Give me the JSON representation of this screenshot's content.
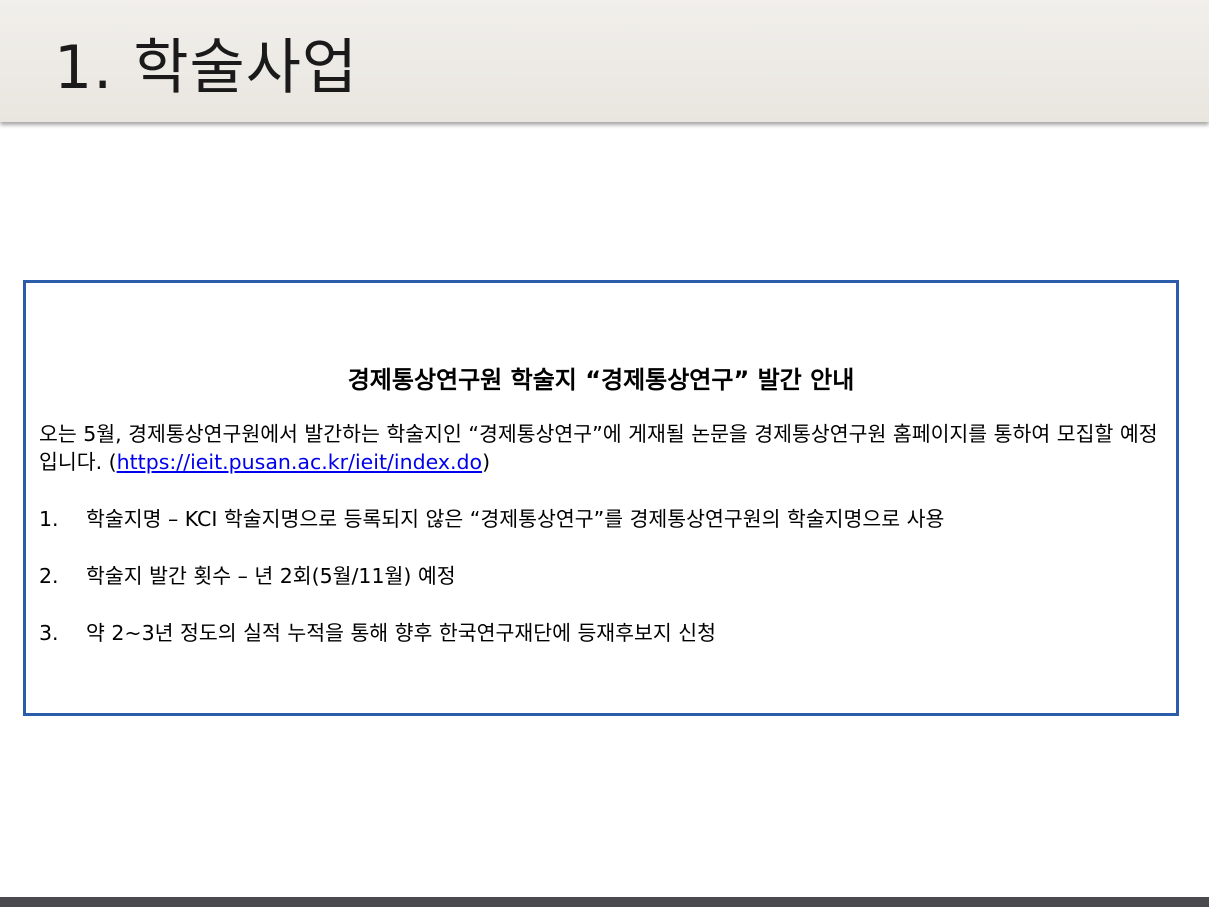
{
  "slide": {
    "title": "1. 학술사업"
  },
  "notice": {
    "heading": "경제통상연구원 학술지 “경제통상연구” 발간 안내",
    "intro_text": "오는 5월, 경제통상연구원에서 발간하는 학술지인 “경제통상연구”에 게재될 논문을 경제통상연구원 홈페이지를 통하여 모집할 예정입니다. (",
    "intro_link": "https://ieit.pusan.ac.kr/ieit/index.do",
    "intro_close": ")",
    "items": [
      {
        "number": "1.",
        "text": "학술지명 – KCI 학술지명으로 등록되지 않은 “경제통상연구”를 경제통상연구원의 학술지명으로 사용"
      },
      {
        "number": "2.",
        "text": "학술지 발간 횟수 – 년 2회(5월/11월) 예정"
      },
      {
        "number": "3.",
        "text": "약 2~3년 정도의 실적 누적을 통해 향후 한국연구재단에 등재후보지 신청"
      }
    ]
  },
  "colors": {
    "box_border": "#2a5caa",
    "header_band": "#ebe8e2",
    "footer_bar": "#4a4a4f",
    "link": "#0000ee"
  }
}
